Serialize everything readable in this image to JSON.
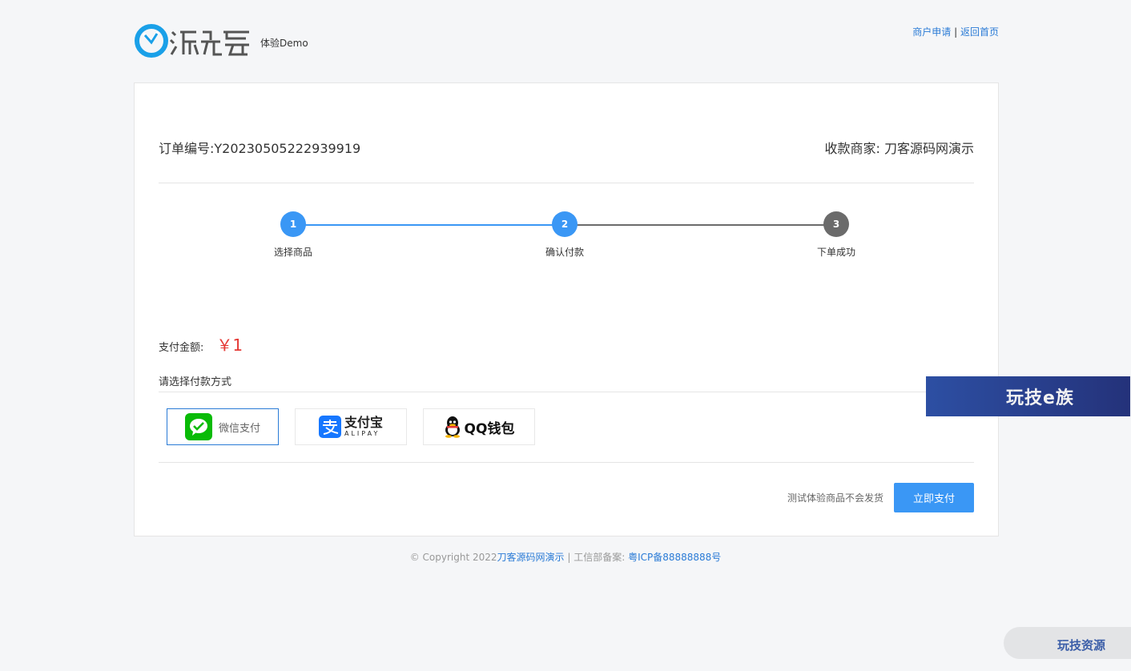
{
  "header": {
    "logo_sub": "体验Demo",
    "merchant_apply": "商户申请",
    "separator": "|",
    "back_home": "返回首页"
  },
  "order": {
    "number_label": "订单编号:Y20230505222939919",
    "merchant_label": "收款商家: 刀客源码网演示"
  },
  "steps": [
    {
      "num": "1",
      "label": "选择商品",
      "state": "done"
    },
    {
      "num": "2",
      "label": "确认付款",
      "state": "active"
    },
    {
      "num": "3",
      "label": "下单成功",
      "state": "pending"
    }
  ],
  "payment": {
    "amount_label": "支付金额:",
    "amount_value": "￥1",
    "method_title": "请选择付款方式",
    "methods": [
      {
        "name": "wechat",
        "label": "微信支付",
        "selected": true
      },
      {
        "name": "alipay",
        "label": "支付宝",
        "sub": "ALIPAY",
        "selected": false
      },
      {
        "name": "qq",
        "label": "QQ钱包",
        "selected": false
      }
    ],
    "note": "测试体验商品不会发货",
    "pay_button": "立即支付"
  },
  "footer": {
    "copyright": "© Copyright 2022",
    "site_link": "刀客源码网演示",
    "icp_prefix": " | 工信部备案: ",
    "icp_link": "粤ICP备88888888号"
  },
  "overlay": {
    "side_banner": "玩技e族",
    "corner_badge": "玩技资源"
  },
  "colors": {
    "accent": "#3a97f5",
    "link": "#2a7bd6",
    "amount": "#e53935",
    "step_pending": "#6b6b6b",
    "wechat_green": "#09bb07",
    "alipay_blue": "#1677ff"
  }
}
